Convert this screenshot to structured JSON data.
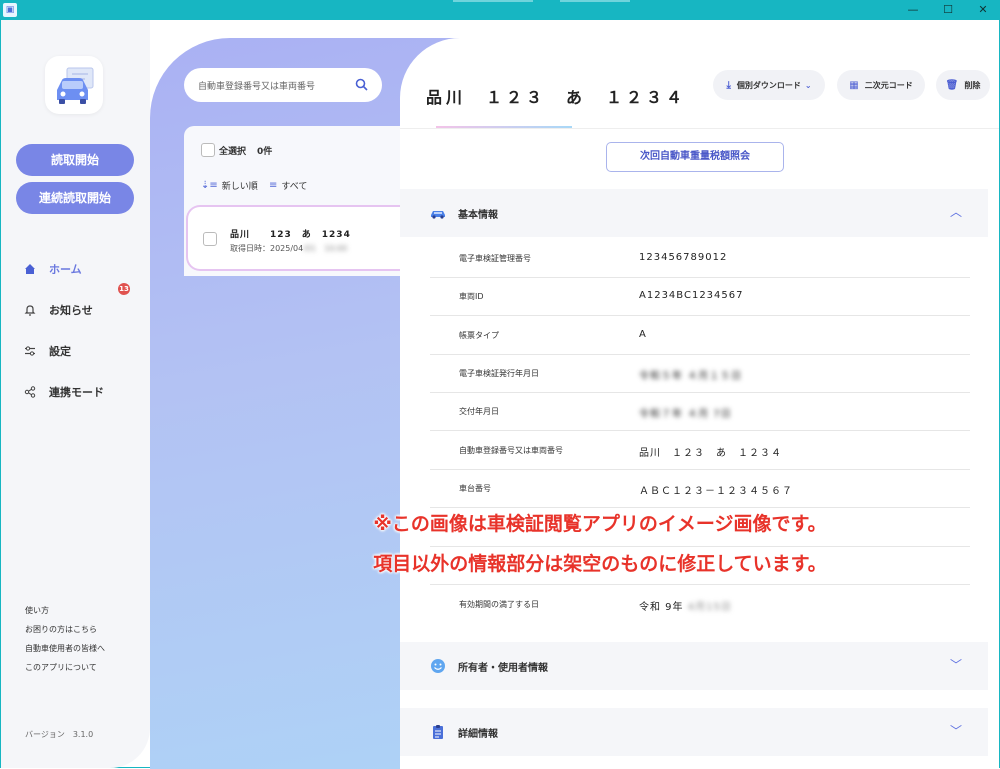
{
  "window": {
    "title_controls": {
      "minimize": "—",
      "maximize": "☐",
      "close": "✕"
    }
  },
  "sidebar": {
    "buttons": [
      {
        "label": "読取開始"
      },
      {
        "label": "連続読取開始"
      }
    ],
    "nav": [
      {
        "label": "ホーム",
        "icon": "home-icon",
        "active": true
      },
      {
        "label": "お知らせ",
        "icon": "bell-icon",
        "badge": "13"
      },
      {
        "label": "設定",
        "icon": "settings-sliders-icon"
      },
      {
        "label": "連携モード",
        "icon": "share-icon"
      }
    ],
    "footer_links": [
      "使い方",
      "お困りの方はこちら",
      "自動車使用者の皆様へ",
      "このアプリについて"
    ],
    "version": "バージョン　3.1.0"
  },
  "list": {
    "search_placeholder": "自動車登録番号又は車両番号",
    "select_all": "全選択",
    "count": "0件",
    "sort_label": "新しい順",
    "filter_label": "すべて",
    "records": [
      {
        "plate": "品川　　123　あ　1234",
        "time_prefix": "取得日時：2025/04",
        "time_hidden": "/01　10:00"
      }
    ]
  },
  "detail": {
    "plate": "品川　１２３　あ　１２３４",
    "header_buttons": {
      "download": "個別ダウンロード",
      "qr": "二次元コード",
      "delete": "削除"
    },
    "tax_button": "次回自動車重量税額照会",
    "sections": {
      "basic": "基本情報",
      "owner": "所有者・使用者情報",
      "detail": "詳細情報"
    },
    "rows": [
      {
        "label": "電子車検証管理番号",
        "value": "123456789012"
      },
      {
        "label": "車両ID",
        "value": "A1234BC1234567"
      },
      {
        "label": "帳票タイプ",
        "value": "A"
      },
      {
        "label": "電子車検証発行年月日",
        "value": "令和５年 ４月１５日",
        "hidden": true
      },
      {
        "label": "交付年月日",
        "value": "令和７年 ４月 7日",
        "hidden": true
      },
      {
        "label": "自動車登録番号又は車両番号",
        "value": "品川　１２３　あ　１２３４"
      },
      {
        "label": "車台番号",
        "value": "ＡＢＣ１２３－１２３４５６７"
      },
      {
        "label": "",
        "value": ""
      },
      {
        "label": "",
        "value": ""
      },
      {
        "label": "有効期間の満了する日",
        "value": "令和 9年",
        "value_hidden": "4月15日"
      }
    ]
  },
  "notice": {
    "line1": "※この画像は車検証閲覧アプリのイメージ画像です。",
    "line2": "項目以外の情報部分は架空のものに修正しています。"
  },
  "colors": {
    "titlebar": "#17b6c2",
    "accent": "#7986e6",
    "danger": "#e0524f",
    "notice": "#e8332a"
  }
}
